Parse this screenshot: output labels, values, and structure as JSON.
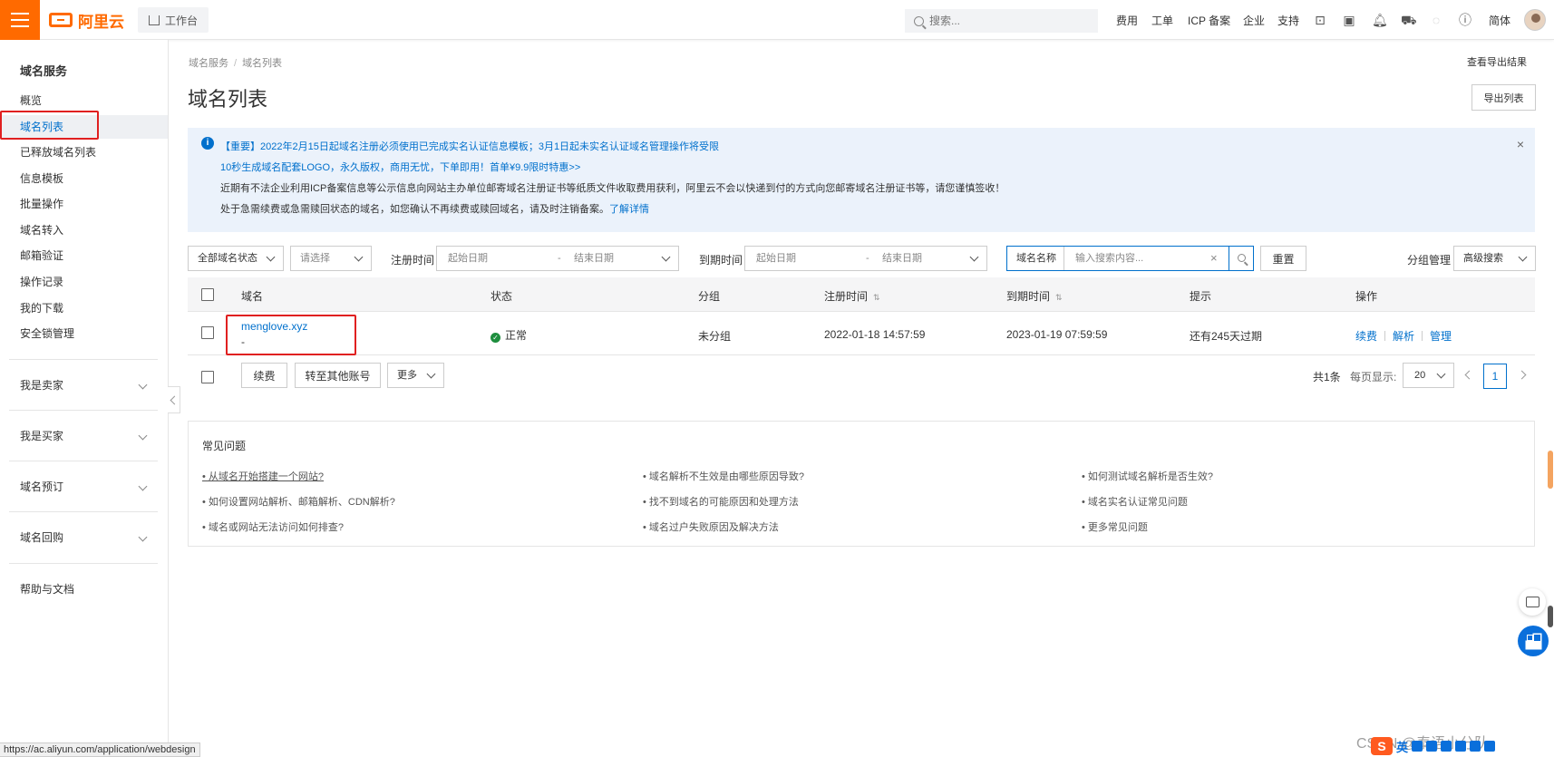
{
  "header": {
    "logo_text": "阿里云",
    "workbench_label": "工作台",
    "search_placeholder": "搜索...",
    "nav": [
      "费用",
      "工单",
      "ICP 备案",
      "企业",
      "支持"
    ],
    "lang": "简体"
  },
  "sidebar": {
    "title": "域名服务",
    "items": [
      {
        "label": "概览"
      },
      {
        "label": "域名列表"
      },
      {
        "label": "已释放域名列表"
      },
      {
        "label": "信息模板"
      },
      {
        "label": "批量操作"
      },
      {
        "label": "域名转入"
      },
      {
        "label": "邮箱验证"
      },
      {
        "label": "操作记录"
      },
      {
        "label": "我的下载"
      },
      {
        "label": "安全锁管理"
      }
    ],
    "groups": [
      {
        "label": "我是卖家"
      },
      {
        "label": "我是买家"
      },
      {
        "label": "域名预订"
      },
      {
        "label": "域名回购"
      }
    ],
    "help": "帮助与文档"
  },
  "breadcrumb": [
    "域名服务",
    "域名列表"
  ],
  "page_title": "域名列表",
  "view_export": "查看导出结果",
  "export_button": "导出列表",
  "notice": {
    "line1": "【重要】2022年2月15日起域名注册必须使用已完成实名认证信息模板；3月1日起未实名认证域名管理操作将受限",
    "line2": "10秒生成域名配套LOGO，永久版权，商用无忧，下单即用！首单¥9.9限时特惠>>",
    "line3": "近期有不法企业利用ICP备案信息等公示信息向网站主办单位邮寄域名注册证书等纸质文件收取费用获利，阿里云不会以快递到付的方式向您邮寄域名注册证书等，请您谨慎签收！",
    "line4": "处于急需续费或急需赎回状态的域名，如您确认不再续费或赎回域名，请及时注销备案。",
    "line4_link": "了解详情",
    "close": "×"
  },
  "filters": {
    "status": "全部域名状态",
    "select": "请选择",
    "reg_time_label": "注册时间",
    "start_date": "起始日期",
    "dash": "-",
    "end_date": "结束日期",
    "exp_time_label": "到期时间",
    "search_field": "域名名称",
    "search_placeholder": "输入搜索内容...",
    "reset": "重置",
    "group_manage": "分组管理",
    "advanced": "高级搜索"
  },
  "table": {
    "headers": [
      "域名",
      "状态",
      "分组",
      "注册时间",
      "到期时间",
      "提示",
      "操作"
    ],
    "rows": [
      {
        "domain": "menglove.xyz",
        "sub": "-",
        "status": "正常",
        "group": "未分组",
        "reg_time": "2022-01-18 14:57:59",
        "exp_time": "2023-01-19 07:59:59",
        "hint": "还有245天过期",
        "actions": [
          "续费",
          "解析",
          "管理"
        ]
      }
    ]
  },
  "bulk": {
    "renew": "续费",
    "transfer": "转至其他账号",
    "more": "更多"
  },
  "pager": {
    "total": "共1条",
    "per_page_label": "每页显示:",
    "per_page": "20",
    "page": "1"
  },
  "faq": {
    "title": "常见问题",
    "items": [
      "• 从域名开始搭建一个网站?",
      "• 域名解析不生效是由哪些原因导致?",
      "• 如何测试域名解析是否生效?",
      "• 如何设置网站解析、邮箱解析、CDN解析?",
      "• 找不到域名的可能原因和处理方法",
      "• 域名实名认证常见问题",
      "• 域名或网站无法访问如何排查?",
      "• 域名过户失败原因及解决方法",
      "• 更多常见问题"
    ]
  },
  "status_url": "https://ac.aliyun.com/application/webdesign",
  "watermark": "CSDN @泰语小分队",
  "ime": {
    "logo": "S",
    "mode": "英"
  },
  "colors": {
    "brand": "#ff6a00",
    "link": "#0070cc",
    "ok": "#1e8e3e",
    "annotation": "#e02020"
  }
}
